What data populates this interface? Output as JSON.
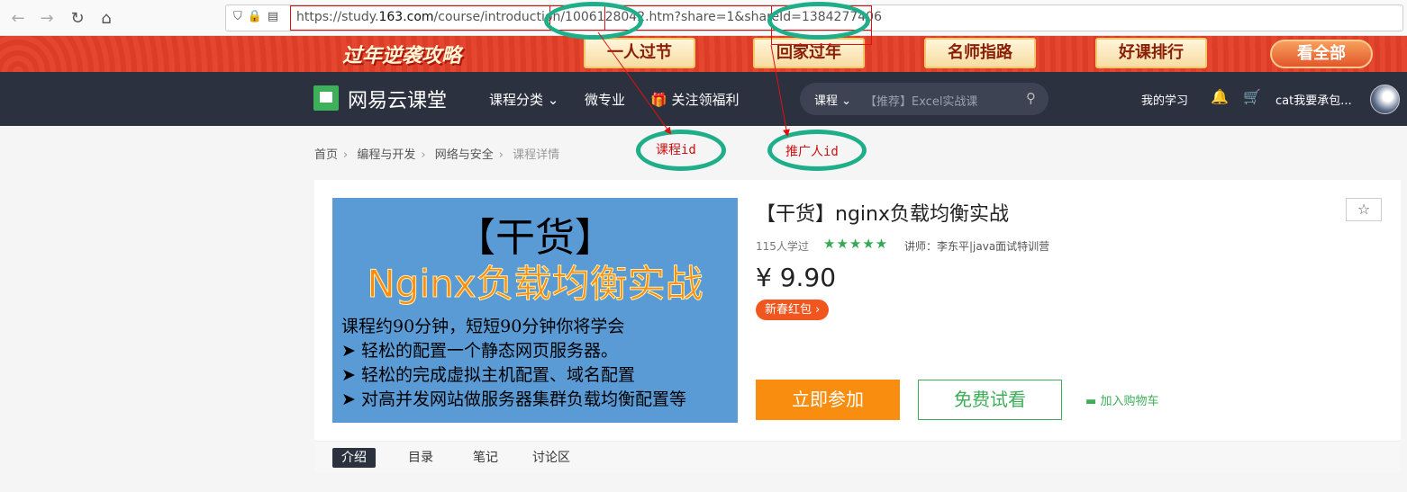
{
  "browser": {
    "back_icon": "←",
    "forward_icon": "→",
    "reload_icon": "↻",
    "home_icon": "⌂",
    "url_prefix": "https://study.",
    "url_domain": "163.com",
    "url_rest": "/course/introduction/1006128042.htm?share=1&shareId=1384277406"
  },
  "promo": {
    "logo": "过年逆袭攻略",
    "tabs": [
      "一人过节",
      "回家过年",
      "名师指路",
      "好课排行"
    ],
    "view_all": "看全部"
  },
  "header": {
    "site_name": "网易云课堂",
    "nav": [
      "课程分类",
      "微专业",
      "关注领福利"
    ],
    "search_category": "课程",
    "search_placeholder": "【推荐】Excel实战课",
    "my_learning": "我的学习",
    "username": "cat我要承包..."
  },
  "breadcrumb": [
    "首页",
    "编程与开发",
    "网络与安全",
    "课程详情"
  ],
  "annotations": {
    "course_id_label": "课程id",
    "promoter_id_label": "推广人id"
  },
  "course": {
    "cover_title": "【干货】",
    "cover_subtitle": "Nginx负载均衡实战",
    "cover_lines": [
      "课程约90分钟，短短90分钟你将学会",
      "➤ 轻松的配置一个静态网页服务器。",
      "➤ 轻松的完成虚拟主机配置、域名配置",
      "➤ 对高并发网站做服务器集群负载均衡配置等"
    ],
    "title": "【干货】nginx负载均衡实战",
    "learners": "115人学过",
    "rating_stars": "★★★★★",
    "teacher": "讲师：李东平|java面试特训营",
    "price": "¥ 9.90",
    "red_packet": "新春红包 ›",
    "join_button": "立即参加",
    "trial_button": "免费试看",
    "cart_button": "加入购物车"
  },
  "tabs": [
    "介绍",
    "目录",
    "笔记",
    "讨论区"
  ],
  "colors": {
    "header_bg": "#2b313f",
    "brand_green": "#3db05a",
    "join_orange": "#f88d10",
    "annotation_red": "#e01010",
    "annotation_teal": "#1fae8a"
  }
}
